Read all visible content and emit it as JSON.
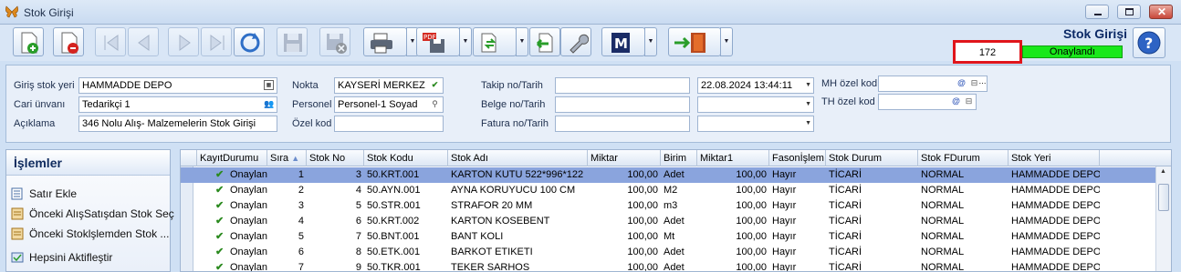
{
  "window": {
    "title": "Stok Girişi"
  },
  "status": {
    "title": "Stok Girişi",
    "count": "172",
    "approval": "Onaylandı"
  },
  "form": {
    "giris_stok_yeri": {
      "label": "Giriş stok yeri",
      "value": "HAMMADDE DEPO"
    },
    "cari_unvani": {
      "label": "Cari ünvanı",
      "value": "Tedarikçi 1"
    },
    "aciklama": {
      "label": "Açıklama",
      "value": "346 Nolu Alış- Malzemelerin Stok Girişi"
    },
    "nokta": {
      "label": "Nokta",
      "value": "KAYSERİ MERKEZ"
    },
    "personel": {
      "label": "Personel",
      "value": "Personel-1 Soyad"
    },
    "ozel_kod": {
      "label": "Özel kod",
      "value": ""
    },
    "takip_no": {
      "label": "Takip no/Tarih",
      "value": "",
      "date": "22.08.2024 13:44:11"
    },
    "belge_no": {
      "label": "Belge no/Tarih",
      "value": ""
    },
    "fatura_no": {
      "label": "Fatura no/Tarih",
      "value": ""
    },
    "mh_ozel_kod": {
      "label": "MH özel kod",
      "value": ""
    },
    "th_ozel_kod": {
      "label": "TH özel kod",
      "value": ""
    }
  },
  "operations": {
    "title": "İşlemler",
    "items": [
      {
        "label": "Satır Ekle",
        "icon": "add-row-icon"
      },
      {
        "label": "Önceki AlışSatışdan Stok Seç",
        "icon": "document-import-icon"
      },
      {
        "label": "Önceki Stoklşlemden Stok ...",
        "icon": "document-import-icon"
      },
      {
        "label": "Hepsini Aktifleştir",
        "icon": "activate-icon"
      }
    ]
  },
  "grid": {
    "columns": [
      "KayıtDurumu",
      "Sıra",
      "Stok No",
      "Stok Kodu",
      "Stok Adı",
      "Miktar",
      "Birim",
      "Miktar1",
      "Fasonİşlem",
      "Stok Durum",
      "Stok FDurum",
      "Stok Yeri"
    ],
    "rows": [
      [
        "Onaylan",
        "1",
        "3",
        "50.KRT.001",
        "KARTON KUTU 522*996*122",
        "100,00",
        "Adet",
        "100,00",
        "Hayır",
        "TİCARİ",
        "NORMAL",
        "HAMMADDE DEPO"
      ],
      [
        "Onaylan",
        "2",
        "4",
        "50.AYN.001",
        "AYNA KORUYUCU 100 CM",
        "100,00",
        "M2",
        "100,00",
        "Hayır",
        "TİCARİ",
        "NORMAL",
        "HAMMADDE DEPO"
      ],
      [
        "Onaylan",
        "3",
        "5",
        "50.STR.001",
        "STRAFOR 20 MM",
        "100,00",
        "m3",
        "100,00",
        "Hayır",
        "TİCARİ",
        "NORMAL",
        "HAMMADDE DEPO"
      ],
      [
        "Onaylan",
        "4",
        "6",
        "50.KRT.002",
        "KARTON KOSEBENT",
        "100,00",
        "Adet",
        "100,00",
        "Hayır",
        "TİCARİ",
        "NORMAL",
        "HAMMADDE DEPO"
      ],
      [
        "Onaylan",
        "5",
        "7",
        "50.BNT.001",
        "BANT KOLI",
        "100,00",
        "Mt",
        "100,00",
        "Hayır",
        "TİCARİ",
        "NORMAL",
        "HAMMADDE DEPO"
      ],
      [
        "Onaylan",
        "6",
        "8",
        "50.ETK.001",
        "BARKOT ETIKETI",
        "100,00",
        "Adet",
        "100,00",
        "Hayır",
        "TİCARİ",
        "NORMAL",
        "HAMMADDE DEPO"
      ],
      [
        "Onaylan",
        "7",
        "9",
        "50.TKR.001",
        "TEKER SARHOS",
        "100,00",
        "Adet",
        "100,00",
        "Hayır",
        "TİCARİ",
        "NORMAL",
        "HAMMADDE DEPO"
      ]
    ]
  },
  "colors": {
    "accent": "#0c2a66",
    "approved": "#19e81b",
    "highlight": "#e0151b",
    "selected_row": "#8aa4dd"
  }
}
